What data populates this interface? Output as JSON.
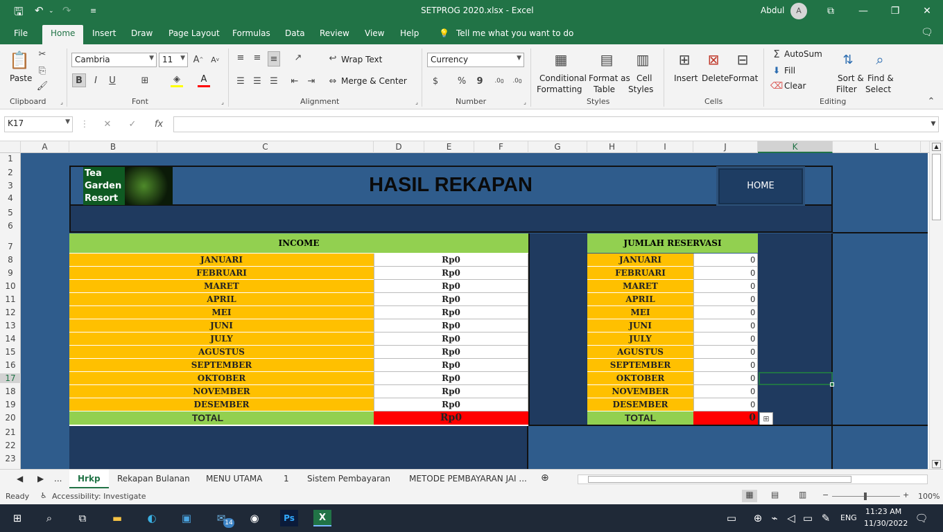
{
  "window": {
    "title": "SETPROG 2020.xlsx  -  Excel",
    "user": "Abdul",
    "avatar_letter": "A"
  },
  "menu": {
    "items": [
      "File",
      "Home",
      "Insert",
      "Draw",
      "Page Layout",
      "Formulas",
      "Data",
      "Review",
      "View",
      "Help"
    ],
    "tell_me": "Tell me what you want to do"
  },
  "ribbon": {
    "clipboard": {
      "paste": "Paste",
      "group": "Clipboard"
    },
    "font": {
      "name": "Cambria",
      "size": "11",
      "bold": "B",
      "italic": "I",
      "underline": "U",
      "group": "Font"
    },
    "alignment": {
      "wrap": "Wrap Text",
      "merge": "Merge & Center",
      "group": "Alignment"
    },
    "number": {
      "format": "Currency",
      "dollar": "$",
      "percent": "%",
      "comma": "9",
      "inc": "←.0 .00",
      "group": "Number"
    },
    "styles": {
      "conditional_line1": "Conditional",
      "conditional_line2": "Formatting",
      "format_table_line1": "Format as",
      "format_table_line2": "Table",
      "cell_styles_line1": "Cell",
      "cell_styles_line2": "Styles",
      "group": "Styles"
    },
    "cells": {
      "insert": "Insert",
      "delete": "Delete",
      "format": "Format",
      "group": "Cells"
    },
    "editing": {
      "autosum": "AutoSum",
      "fill": "Fill",
      "clear": "Clear",
      "sort_line1": "Sort &",
      "sort_line2": "Filter",
      "find_line1": "Find &",
      "find_line2": "Select",
      "group": "Editing"
    }
  },
  "formula_bar": {
    "name_box": "K17",
    "fx": "fx",
    "formula": ""
  },
  "columns": [
    "A",
    "B",
    "C",
    "D",
    "E",
    "F",
    "G",
    "H",
    "I",
    "J",
    "K",
    "L"
  ],
  "rows": [
    "1",
    "2",
    "3",
    "4",
    "5",
    "6",
    "7",
    "8",
    "9",
    "10",
    "11",
    "12",
    "13",
    "14",
    "15",
    "16",
    "17",
    "18",
    "19",
    "20",
    "21",
    "22",
    "23"
  ],
  "sheet": {
    "logo": {
      "line1": "Tea",
      "line2": "Garden",
      "line3": "Resort"
    },
    "title": "HASIL REKAPAN",
    "home_button": "HOME",
    "income": {
      "header": "INCOME",
      "rows": [
        {
          "month": "JANUARI",
          "value": "Rp0"
        },
        {
          "month": "FEBRUARI",
          "value": "Rp0"
        },
        {
          "month": "MARET",
          "value": "Rp0"
        },
        {
          "month": "APRIL",
          "value": "Rp0"
        },
        {
          "month": "MEI",
          "value": "Rp0"
        },
        {
          "month": "JUNI",
          "value": "Rp0"
        },
        {
          "month": "JULY",
          "value": "Rp0"
        },
        {
          "month": "AGUSTUS",
          "value": "Rp0"
        },
        {
          "month": "SEPTEMBER",
          "value": "Rp0"
        },
        {
          "month": "OKTOBER",
          "value": "Rp0"
        },
        {
          "month": "NOVEMBER",
          "value": "Rp0"
        },
        {
          "month": "DESEMBER",
          "value": "Rp0"
        }
      ],
      "total_label": "TOTAL",
      "total_value": "Rp0"
    },
    "reservasi": {
      "header": "JUMLAH RESERVASI",
      "rows": [
        {
          "month": "JANUARI",
          "value": "0"
        },
        {
          "month": "FEBRUARI",
          "value": "0"
        },
        {
          "month": "MARET",
          "value": "0"
        },
        {
          "month": "APRIL",
          "value": "0"
        },
        {
          "month": "MEI",
          "value": "0"
        },
        {
          "month": "JUNI",
          "value": "0"
        },
        {
          "month": "JULY",
          "value": "0"
        },
        {
          "month": "AGUSTUS",
          "value": "0"
        },
        {
          "month": "SEPTEMBER",
          "value": "0"
        },
        {
          "month": "OKTOBER",
          "value": "0"
        },
        {
          "month": "NOVEMBER",
          "value": "0"
        },
        {
          "month": "DESEMBER",
          "value": "0"
        }
      ],
      "total_label": "TOTAL",
      "total_value": "0"
    }
  },
  "tabs": [
    "Hrkp",
    "Rekapan Bulanan",
    "MENU UTAMA",
    "1",
    "Sistem Pembayaran",
    "METODE PEMBAYARAN JAI ..."
  ],
  "tabs_ellipsis": "...",
  "status": {
    "ready": "Ready",
    "accessibility": "Accessibility: Investigate",
    "zoom": "100%"
  },
  "taskbar": {
    "time": "11:23 AM",
    "date": "11/30/2022",
    "lang": "ENG",
    "mail_badge": "14"
  },
  "colors": {
    "excel_green": "#217346",
    "sheet_blue": "#2f5c8c",
    "dark_navy": "#1f3a5f",
    "orange": "#ffc000",
    "green_hdr": "#92d050",
    "red": "#ff0000"
  }
}
